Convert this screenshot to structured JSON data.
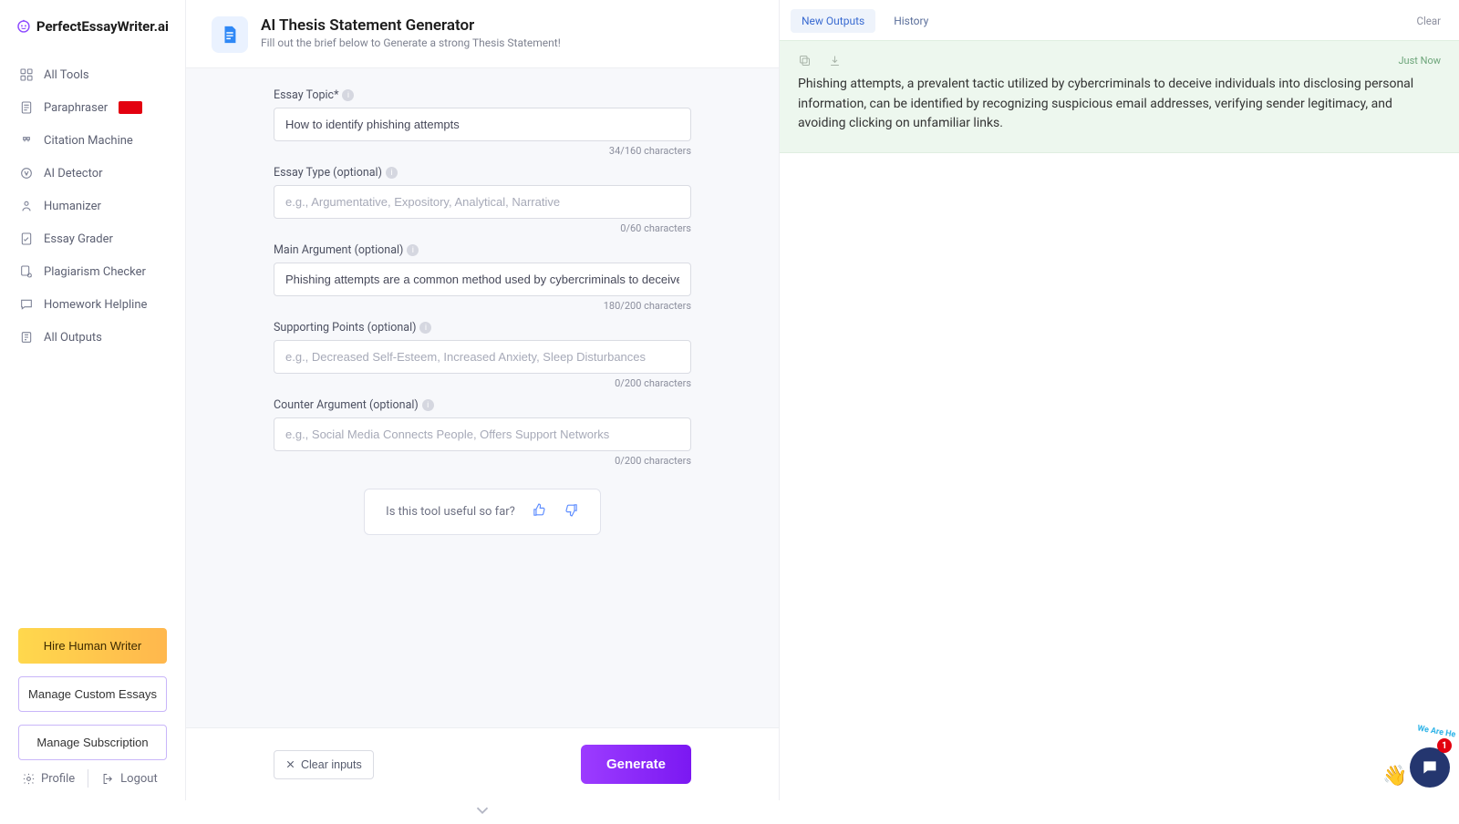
{
  "brand": {
    "name_a": "PerfectEssayWriter",
    "name_b": ".ai"
  },
  "sidebar": {
    "items": [
      {
        "label": "All Tools"
      },
      {
        "label": "Paraphraser",
        "badge": true
      },
      {
        "label": "Citation Machine"
      },
      {
        "label": "AI Detector"
      },
      {
        "label": "Humanizer"
      },
      {
        "label": "Essay Grader"
      },
      {
        "label": "Plagiarism Checker"
      },
      {
        "label": "Homework Helpline"
      },
      {
        "label": "All Outputs"
      }
    ],
    "hire": "Hire Human Writer",
    "manage_essays": "Manage Custom Essays",
    "manage_sub": "Manage Subscription",
    "profile": "Profile",
    "logout": "Logout"
  },
  "tool": {
    "title": "AI Thesis Statement Generator",
    "subtitle": "Fill out the brief below to Generate a strong Thesis Statement!"
  },
  "form": {
    "topic": {
      "label": "Essay Topic*",
      "value": "How to identify phishing attempts",
      "count": "34/160 characters"
    },
    "type": {
      "label": "Essay Type (optional)",
      "placeholder": "e.g., Argumentative, Expository, Analytical, Narrative",
      "count": "0/60 characters"
    },
    "argument": {
      "label": "Main Argument (optional)",
      "value": "Phishing attempts are a common method used by cybercriminals to deceive individuals intc",
      "count": "180/200 characters"
    },
    "support": {
      "label": "Supporting Points (optional)",
      "placeholder": "e.g., Decreased Self-Esteem, Increased Anxiety, Sleep Disturbances",
      "count": "0/200 characters"
    },
    "counter": {
      "label": "Counter Argument (optional)",
      "placeholder": "e.g., Social Media Connects People, Offers Support Networks",
      "count": "0/200 characters"
    },
    "feedback": "Is this tool useful so far?",
    "clear": "Clear inputs",
    "generate": "Generate"
  },
  "right": {
    "tab_new": "New Outputs",
    "tab_history": "History",
    "clear": "Clear",
    "time": "Just Now",
    "output": "Phishing attempts, a prevalent tactic utilized by cybercriminals to deceive individuals into disclosing personal information, can be identified by recognizing suspicious email addresses, verifying sender legitimacy, and avoiding clicking on unfamiliar links."
  },
  "chat": {
    "badge": "1",
    "arc": "We Are He"
  }
}
